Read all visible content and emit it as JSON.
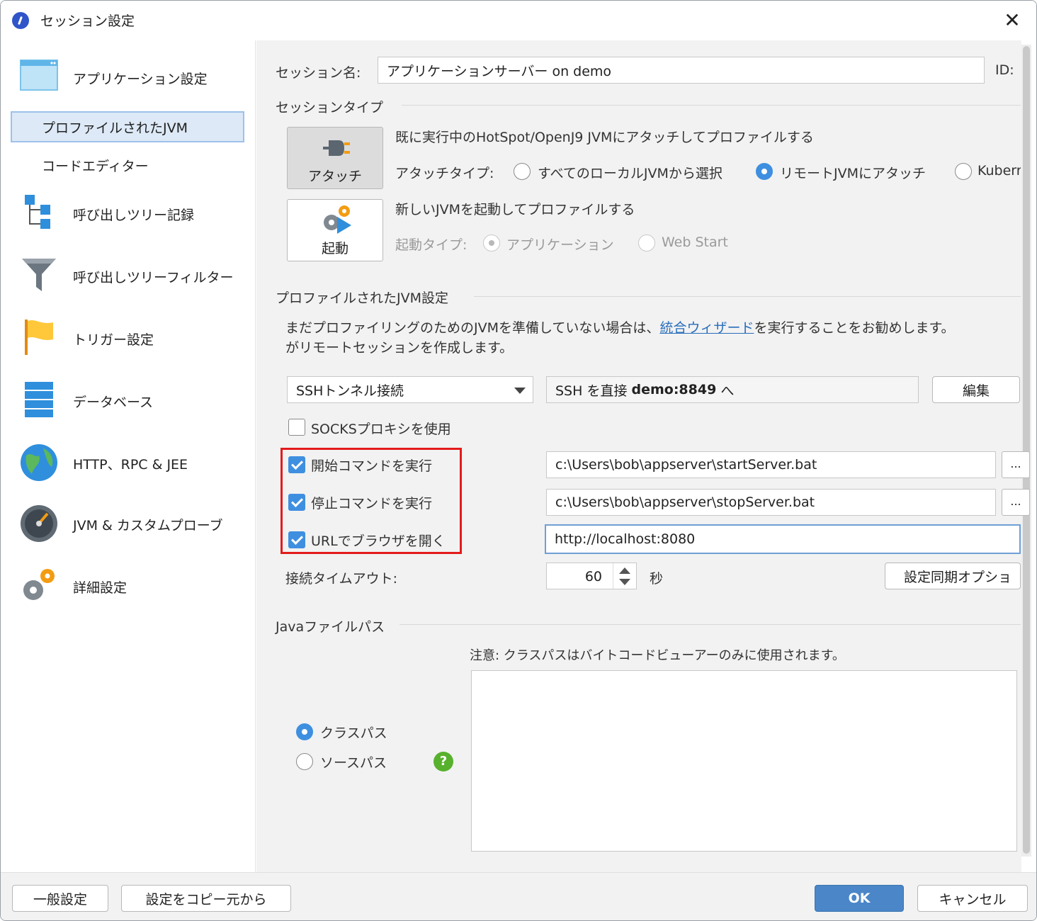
{
  "window": {
    "title": "セッション設定"
  },
  "sidebar": {
    "app_settings": "アプリケーション設定",
    "profiled_jvm": "プロファイルされたJVM",
    "code_editor": "コードエディター",
    "call_tree_recording": "呼び出しツリー記録",
    "call_tree_filter": "呼び出しツリーフィルター",
    "trigger_settings": "トリガー設定",
    "database": "データベース",
    "http_rpc_jee": "HTTP、RPC & JEE",
    "jvm_custom_probes": "JVM & カスタムプローブ",
    "advanced_settings": "詳細設定"
  },
  "session": {
    "name_label": "セッション名:",
    "name_value": "アプリケーションサーバー on demo",
    "id_label": "ID:",
    "type_heading": "セッションタイプ",
    "attach_tile": "アタッチ",
    "launch_tile": "起動",
    "attach_desc": "既に実行中のHotSpot/OpenJ9 JVMにアタッチしてプロファイルする",
    "attach_type_label": "アタッチタイプ:",
    "attach_opt_local": "すべてのローカルJVMから選択",
    "attach_opt_remote": "リモートJVMにアタッチ",
    "attach_opt_kube": "Kuberr",
    "launch_desc": "新しいJVMを起動してプロファイルする",
    "launch_type_label": "起動タイプ:",
    "launch_opt_app": "アプリケーション",
    "launch_opt_webstart": "Web Start"
  },
  "jvm_settings": {
    "heading": "プロファイルされたJVM設定",
    "info_pre": "まだプロファイリングのためのJVMを準備していない場合は、",
    "info_link": "統合ウィザード",
    "info_post": "を実行することをお勧めします。",
    "info_line2": "がリモートセッションを作成します。",
    "connection_type": "SSHトンネル接続",
    "ssh_summary_pre": "SSH を直接 ",
    "ssh_summary_host": "demo:8849",
    "ssh_summary_post": " へ",
    "edit_button": "編集",
    "socks_label": "SOCKSプロキシを使用",
    "start_cmd_label": "開始コマンドを実行",
    "start_cmd_value": "c:\\Users\\bob\\appserver\\startServer.bat",
    "stop_cmd_label": "停止コマンドを実行",
    "stop_cmd_value": "c:\\Users\\bob\\appserver\\stopServer.bat",
    "open_url_label": "URLでブラウザを開く",
    "open_url_value": "http://localhost:8080",
    "browse_label": "...",
    "timeout_label": "接続タイムアウト:",
    "timeout_value": "60",
    "timeout_unit": "秒",
    "sync_button": "設定同期オプショ"
  },
  "java_paths": {
    "heading": "Javaファイルパス",
    "note": "注意: クラスパスはバイトコードビューアーのみに使用されます。",
    "classpath": "クラスパス",
    "sourcepath": "ソースパス",
    "help": "?"
  },
  "footer": {
    "general_settings": "一般設定",
    "copy_settings": "設定をコピー元から",
    "ok": "OK",
    "cancel": "キャンセル"
  }
}
